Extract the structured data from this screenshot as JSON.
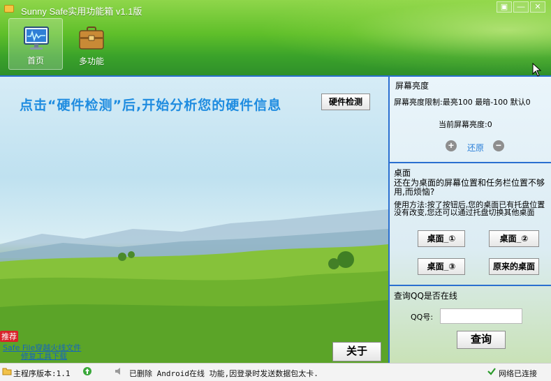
{
  "window": {
    "title": "Sunny Safe实用功能箱 v1.1版",
    "controls": [
      "▣",
      "—",
      "✕"
    ]
  },
  "nav": [
    {
      "label": "首页",
      "icon": "monitor-icon",
      "active": true
    },
    {
      "label": "多功能",
      "icon": "toolbox-icon",
      "active": false
    }
  ],
  "main": {
    "headline": "点击“硬件检测”后,开始分析您的硬件信息",
    "detect_button": "硬件检测",
    "recommend_tag": "推荐",
    "links": [
      "Safe File穿越火线文件",
      "修复工具下载"
    ],
    "about_button": "关于"
  },
  "brightness": {
    "title": "屏幕亮度",
    "limits": "屏幕亮度限制:最亮100 最暗-100 默认0",
    "current": "当前屏幕亮度:0",
    "increase": "+",
    "restore": "还原",
    "decrease": "−"
  },
  "desktop": {
    "title": "桌面",
    "question": "还在为桌面的屏幕位置和任务栏位置不够用,而烦恼?",
    "usage": "使用方法:按了按钮后,您的桌面已有托盘位置没有改变,您还可以通过托盘切换其他桌面",
    "buttons": [
      "桌面_①",
      "桌面_②",
      "桌面_③",
      "原来的桌面"
    ]
  },
  "qq": {
    "title": "查询QQ是否在线",
    "label": "QQ号:",
    "input_value": "",
    "query_button": "查询"
  },
  "status": {
    "version": "主程序版本:1.1",
    "message": "已删除 Android在线 功能,因登录时发送数据包太卡.",
    "network": "网络已连接"
  },
  "colors": {
    "accent": "#2a6fd0",
    "header_green": "#5fbf2a",
    "headline_blue": "#1f8ce0"
  }
}
